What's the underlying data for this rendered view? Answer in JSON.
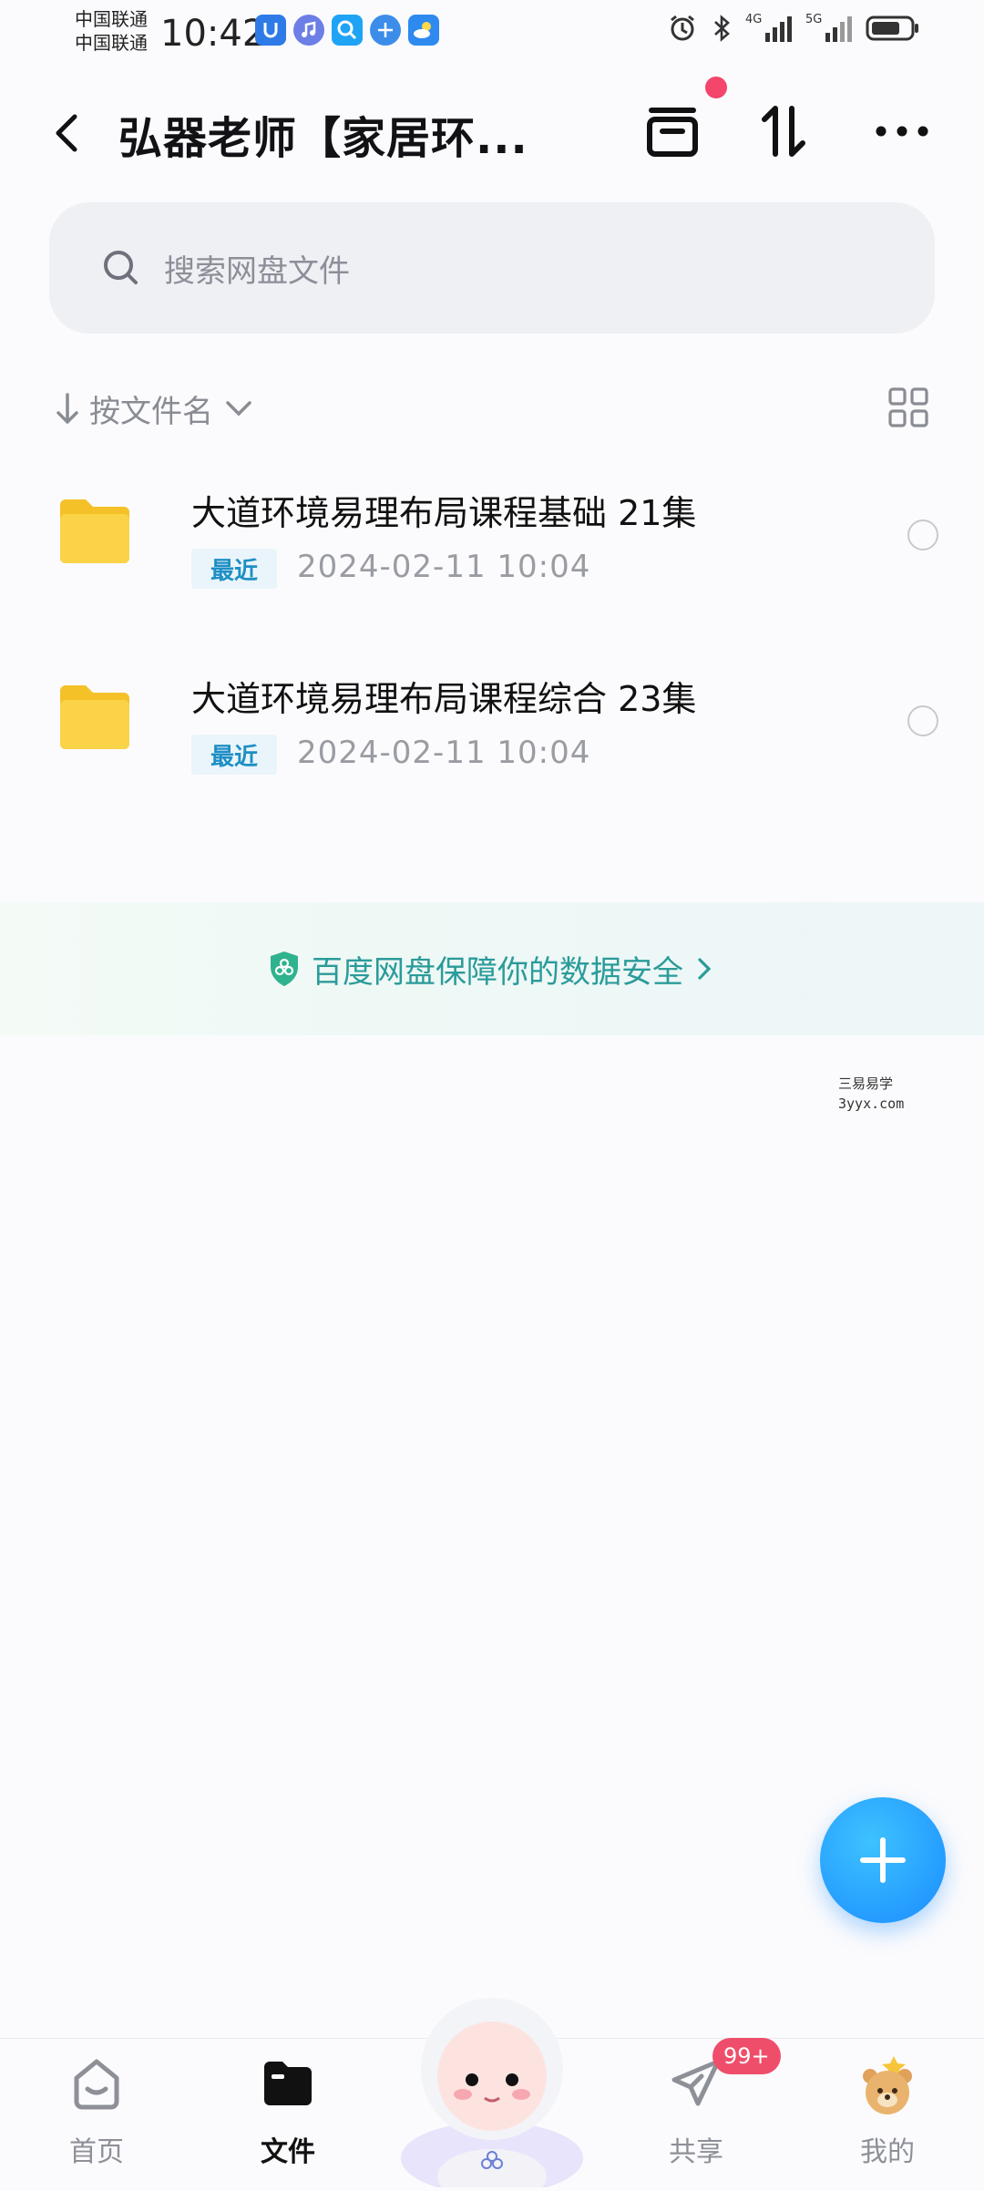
{
  "status_bar": {
    "carrier_1": "中国联通",
    "carrier_2": "中国联通",
    "time": "10:42",
    "network_4g": "4G",
    "network_5g": "5G"
  },
  "header": {
    "title": "弘器老师【家居环..."
  },
  "search": {
    "placeholder": "搜索网盘文件"
  },
  "sort": {
    "label": "按文件名"
  },
  "files": [
    {
      "name": "大道环境易理布局课程基础 21集",
      "badge": "最近",
      "date": "2024-02-11  10:04"
    },
    {
      "name": "大道环境易理布局课程综合 23集",
      "badge": "最近",
      "date": "2024-02-11  10:04"
    }
  ],
  "banner": {
    "text": "百度网盘保障你的数据安全"
  },
  "watermark": {
    "line1": "三易易学",
    "line2": "3yyx.com"
  },
  "nav": {
    "home": "首页",
    "files": "文件",
    "share": "共享",
    "share_badge": "99+",
    "me": "我的"
  },
  "colors": {
    "accent": "#1a8cff",
    "badge_red": "#ef4e6a",
    "banner_text": "#2a9b9a",
    "folder": "#f9cb2f"
  }
}
